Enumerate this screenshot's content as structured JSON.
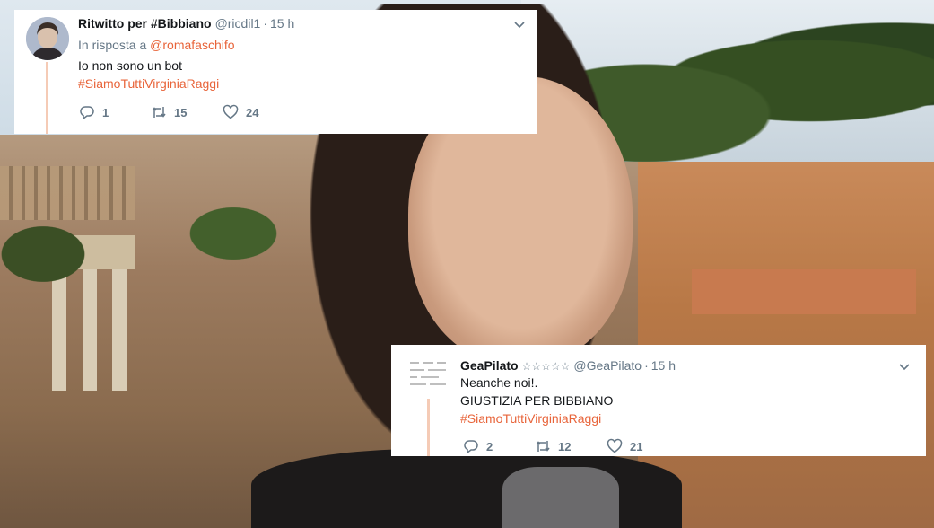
{
  "tweets": [
    {
      "retweeter": "Ritwitto per #Bibbiano",
      "handle": "@ricdil1",
      "separator": "·",
      "time": "15 h",
      "reply_prefix": "In risposta a",
      "reply_to": "@romafaschifo",
      "text": "Io non sono un bot",
      "hashtag": "#SiamoTuttiVirginiaRaggi",
      "replies": "1",
      "retweets": "15",
      "likes": "24",
      "avatar_icon": "user-portrait-icon"
    },
    {
      "name": "GeaPilato",
      "stars": "☆☆☆☆☆",
      "handle": "@GeaPilato",
      "separator": "·",
      "time": "15 h",
      "line1": "Neanche noi!.",
      "line2": "GIUSTIZIA PER BIBBIANO",
      "hashtag": "#SiamoTuttiVirginiaRaggi",
      "replies": "2",
      "retweets": "12",
      "likes": "21",
      "avatar_icon": "text-image-avatar-icon"
    }
  ],
  "colors": {
    "accent": "#e8643a",
    "meta_text": "#657786",
    "primary_text": "#14171a",
    "thread_line": "#f5cbb6"
  }
}
